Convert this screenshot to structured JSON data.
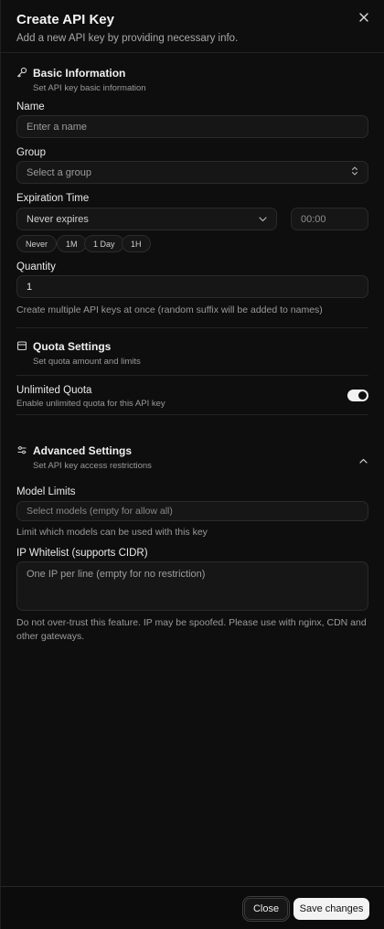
{
  "dialog": {
    "title": "Create API Key",
    "subtitle": "Add a new API key by providing necessary info."
  },
  "basic": {
    "title": "Basic Information",
    "desc": "Set API key basic information",
    "icon": "key-icon",
    "name_label": "Name",
    "name_placeholder": "Enter a name",
    "group_label": "Group",
    "group_placeholder": "Select a group",
    "expiration_label": "Expiration Time",
    "expiration_value": "Never expires",
    "time_value": "00:00",
    "presets": [
      "Never",
      "1M",
      "1 Day",
      "1H"
    ],
    "quantity_label": "Quantity",
    "quantity_value": "1",
    "quantity_help": "Create multiple API keys at once (random suffix will be added to names)"
  },
  "quota": {
    "title": "Quota Settings",
    "desc": "Set quota amount and limits",
    "icon": "wallet-icon",
    "unlimited_label": "Unlimited Quota",
    "unlimited_desc": "Enable unlimited quota for this API key",
    "unlimited_on": true
  },
  "advanced": {
    "title": "Advanced Settings",
    "desc": "Set API key access restrictions",
    "icon": "sliders-icon",
    "model_label": "Model Limits",
    "model_placeholder": "Select models (empty for allow all)",
    "model_help": "Limit which models can be used with this key",
    "ip_label": "IP Whitelist (supports CIDR)",
    "ip_placeholder": "One IP per line (empty for no restriction)",
    "ip_help": "Do not over-trust this feature. IP may be spoofed. Please use with nginx, CDN and other gateways."
  },
  "footer": {
    "close_label": "Close",
    "save_label": "Save changes"
  }
}
